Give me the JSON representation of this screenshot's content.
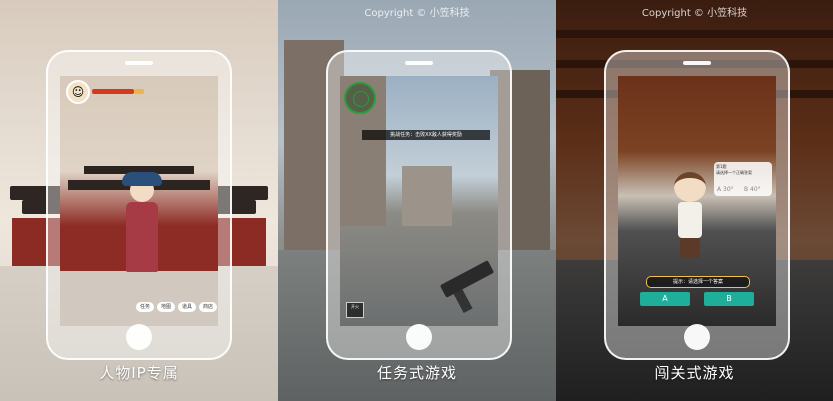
{
  "panels": [
    {
      "caption": "人物IP专属",
      "screen": {
        "menu": [
          "任务",
          "地图",
          "道具",
          "商店"
        ]
      }
    },
    {
      "copyright": "Copyright © 小笠科技",
      "caption": "任务式游戏",
      "screen": {
        "mission_text": "挑战任务：击败XX敌人获得奖励",
        "side_button": "开火"
      }
    },
    {
      "copyright": "Copyright © 小笠科技",
      "caption": "闯关式游戏",
      "screen": {
        "quiz_title": "第1题",
        "quiz_text": "请选择一个正确答案",
        "option_a_label": "A 30°",
        "option_b_label": "B 40°",
        "hint": "提示：请选择一个答案",
        "answer_a": "A",
        "answer_b": "B"
      }
    }
  ]
}
